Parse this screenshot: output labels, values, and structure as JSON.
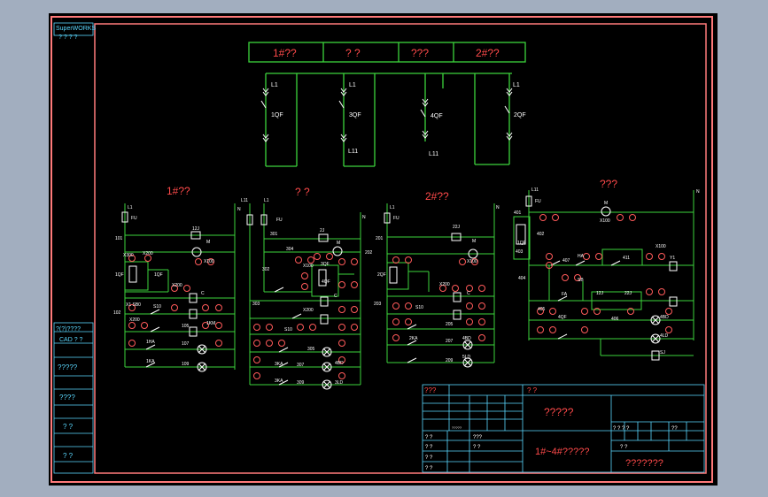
{
  "colors": {
    "background": "#000000",
    "frame": "#ff7a7a",
    "wire": "#3cd43c",
    "text_red": "#ff4a4a",
    "text_white": "#ffffff",
    "border_cyan": "#5ad8ff"
  },
  "logo": {
    "line1": "SuperWORKS",
    "line2": "? ? ? ?"
  },
  "left_strip": {
    "r1": "?(?)????",
    "r2": "CAD ? ?",
    "r3": "?????",
    "r4": "????",
    "r5": "? ?",
    "r6": "? ?"
  },
  "top_bus": {
    "c1": "1#??",
    "c2": "?   ?",
    "c3": "???",
    "c4": "2#??"
  },
  "breakers": {
    "b1": {
      "top": "L1",
      "mid": "1QF"
    },
    "b2": {
      "top": "L1",
      "mid": "3QF",
      "bot": "L11"
    },
    "b3": {
      "mid": "4QF",
      "bot": "L11"
    },
    "b4": {
      "top": "L1",
      "mid": "2QF"
    }
  },
  "section_titles": {
    "s1": "1#??",
    "s2": "?   ?",
    "s3": "2#??",
    "s4": "???"
  },
  "s1_labels": {
    "l1": "L1",
    "fu": "FU",
    "n": "N",
    "w101": "101",
    "r12j": "12J",
    "m": "M",
    "x100": "X100",
    "k": "X200",
    "x200b": "X200",
    "qf": "1QF",
    "x300": "X300",
    "ww": "102",
    "sb": "X1 SB0",
    "s10": "S10",
    "x200c": "X200",
    "qf2": "1QF",
    "c": "C",
    "b1": "1HA",
    "b2": "105",
    "b3": "1KA",
    "b4": "107",
    "b5": "109",
    "c2": "1KM"
  },
  "s2_labels": {
    "l11": "L11",
    "l1": "L1",
    "fu": "FU",
    "n": "N",
    "r2j": "2J",
    "m": "M",
    "w301": "301",
    "w302": "302",
    "w303": "303",
    "w304": "304",
    "x100": "X100",
    "x200": "X200",
    "s10": "S10",
    "c": "C",
    "b1": "305",
    "b2": "307",
    "b3": "309",
    "b4": "3KA",
    "b5": "3KA",
    "c1": "3QF",
    "c2": "4QF",
    "lamp1": "4BD",
    "lamp2": "3LD"
  },
  "s3_labels": {
    "l1": "L1",
    "fu": "FU",
    "n": "N",
    "r22j": "22J",
    "m": "M",
    "x100": "X100",
    "x200": "X200",
    "qf": "2QF",
    "w201": "201",
    "w202": "202",
    "w203": "203",
    "s10": "S10",
    "c": "C",
    "b1": "205",
    "b2": "2KA",
    "b3": "207",
    "b4": "209",
    "lamp1": "4BD",
    "lamp2": "5LD"
  },
  "s4_labels": {
    "l11": "L11",
    "fu": "FU",
    "n": "N",
    "m": "M",
    "x100": "X100",
    "w401": "401",
    "w402": "402",
    "w403": "403",
    "w404": "404",
    "w405": "405",
    "w406": "406",
    "w407": "407",
    "ha": "HA",
    "sb": "SB",
    "fa": "FA",
    "r12j": "12J",
    "r22j": "22J",
    "r411": "411",
    "x100b": "X100",
    "y1": "Y1",
    "c1": "4QF",
    "c2": "1QF",
    "lamp1": "4BD",
    "lamp2": "4LD",
    "sj": "SJ"
  },
  "title_block": {
    "top_left": "???",
    "top_mid": "?  ?",
    "big": "?????",
    "bot_title": "1#~4#?????",
    "bot_right": "???????",
    "small": [
      "? ?",
      "???",
      "? ?",
      "? ?",
      "? ?",
      "? ?",
      "? ? ? ?",
      "??",
      "? ?"
    ],
    "grid_code": "?????"
  }
}
